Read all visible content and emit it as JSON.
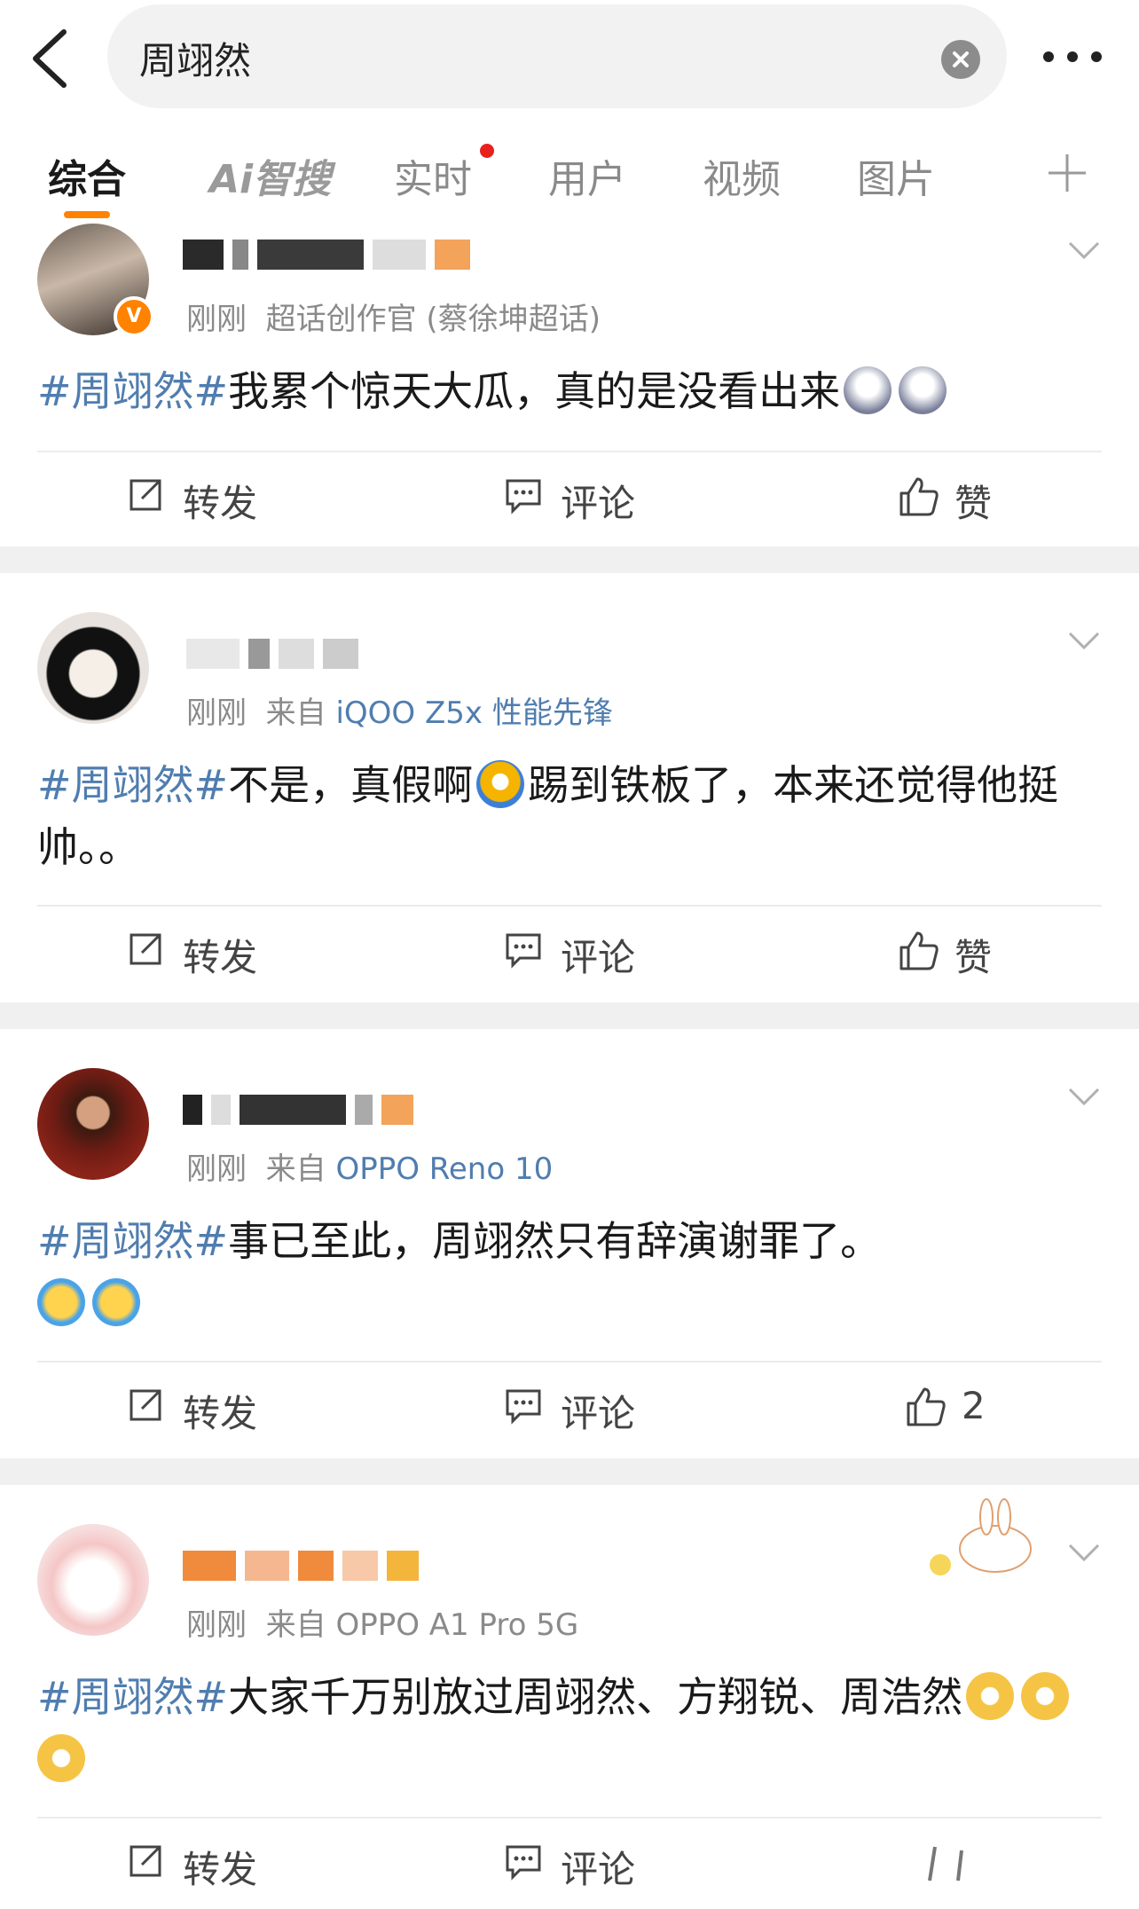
{
  "search": {
    "query": "周翊然"
  },
  "tabs": [
    {
      "label": "综合"
    },
    {
      "label": "Ai智搜"
    },
    {
      "label": "实时"
    },
    {
      "label": "用户"
    },
    {
      "label": "视频"
    },
    {
      "label": "图片"
    }
  ],
  "posts": [
    {
      "time": "刚刚",
      "meta_extra": "超话创作官 (蔡徐坤超话)",
      "source": "",
      "hashtag": "#周翊然#",
      "text": "我累个惊天大瓜，真的是没看出来",
      "actions": {
        "repost": "转发",
        "comment": "评论",
        "like": "赞"
      }
    },
    {
      "time": "刚刚",
      "meta_extra": "来自",
      "source": "iQOO Z5x 性能先锋",
      "hashtag": "#周翊然#",
      "text_a": "不是，真假啊",
      "text_b": "踢到铁板了，本来还觉得他挺帅。。",
      "actions": {
        "repost": "转发",
        "comment": "评论",
        "like": "赞"
      }
    },
    {
      "time": "刚刚",
      "meta_extra": "来自",
      "source": "OPPO Reno 10",
      "hashtag": "#周翊然#",
      "text": "事已至此，周翊然只有辞演谢罪了。",
      "actions": {
        "repost": "转发",
        "comment": "评论",
        "like": "2"
      }
    },
    {
      "time": "刚刚",
      "meta_extra": "来自",
      "source": "OPPO A1 Pro 5G",
      "hashtag": "#周翊然#",
      "text": "大家千万别放过周翊然、方翔锐、周浩然",
      "actions": {
        "repost": "转发",
        "comment": "评论"
      }
    }
  ],
  "colors": {
    "accent": "#ff8200",
    "link": "#507daf",
    "separator": "#f0f0f0"
  },
  "icons": [
    "back-arrow-icon",
    "clear-icon",
    "more-icon",
    "plus-icon",
    "chevron-down-icon",
    "repost-icon",
    "comment-icon",
    "thumbs-up-icon",
    "verified-badge-icon"
  ]
}
